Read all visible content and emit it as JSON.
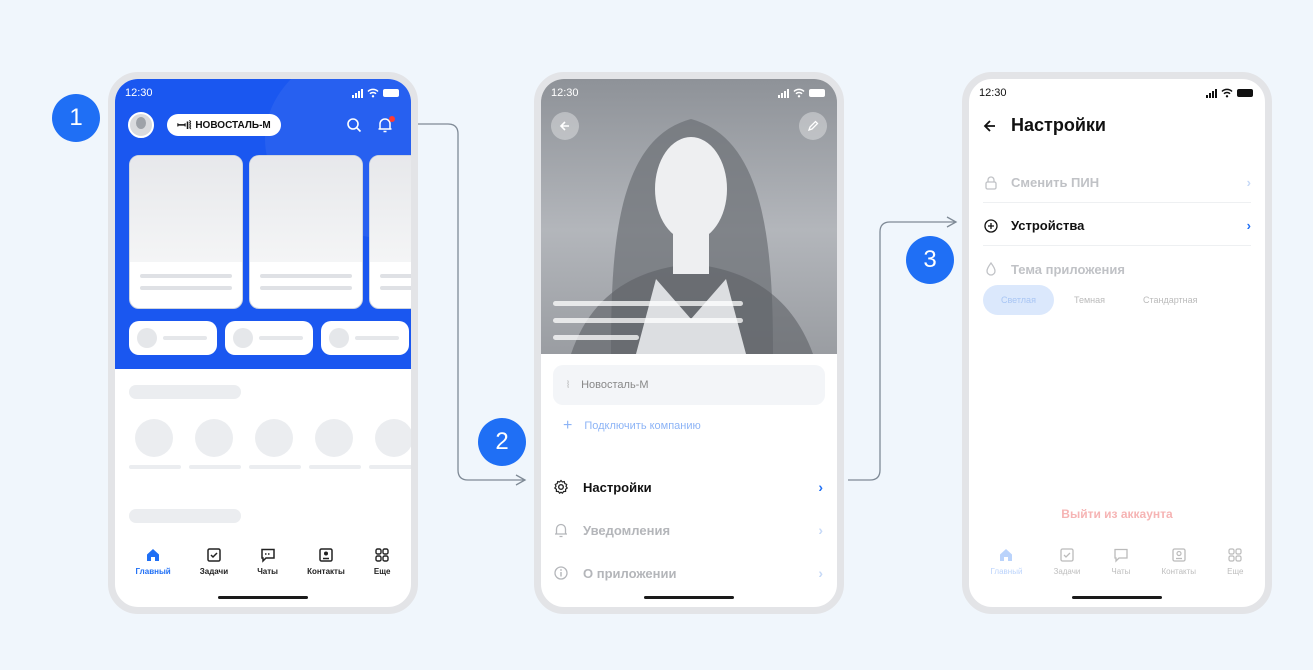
{
  "steps": [
    "1",
    "2",
    "3"
  ],
  "colors": {
    "accent": "#1f6ff5",
    "hero": "#1a57f0",
    "background": "#f0f6fc",
    "logout": "#f6b4b4"
  },
  "phone1": {
    "time": "12:30",
    "company": "НОВОСТАЛЬ-М",
    "icons": [
      "search-icon",
      "bell-icon"
    ],
    "tabs": [
      {
        "label": "Главный",
        "icon": "home-icon",
        "active": true
      },
      {
        "label": "Задачи",
        "icon": "checkbox-icon",
        "active": false
      },
      {
        "label": "Чаты",
        "icon": "chat-icon",
        "active": false
      },
      {
        "label": "Контакты",
        "icon": "contact-card-icon",
        "active": false
      },
      {
        "label": "Еще",
        "icon": "grid-icon",
        "active": false
      }
    ]
  },
  "phone2": {
    "time": "12:30",
    "company": "Новосталь-М",
    "connect_label": "Подключить компанию",
    "menu": [
      {
        "label": "Настройки",
        "icon": "gear-icon"
      },
      {
        "label": "Уведомления",
        "icon": "bell-icon"
      },
      {
        "label": "О приложении",
        "icon": "info-icon"
      }
    ]
  },
  "phone3": {
    "time": "12:30",
    "title": "Настройки",
    "rows": [
      {
        "label": "Сменить ПИН",
        "icon": "lock-icon"
      },
      {
        "label": "Устройства",
        "icon": "plus-circle-icon"
      },
      {
        "label": "Тема приложения",
        "icon": "drop-icon"
      }
    ],
    "theme_options": [
      "Светлая",
      "Темная",
      "Стандартная"
    ],
    "theme_selected": "Светлая",
    "logout_label": "Выйти из аккаунта",
    "tabs": [
      "Главный",
      "Задачи",
      "Чаты",
      "Контакты",
      "Еще"
    ]
  }
}
